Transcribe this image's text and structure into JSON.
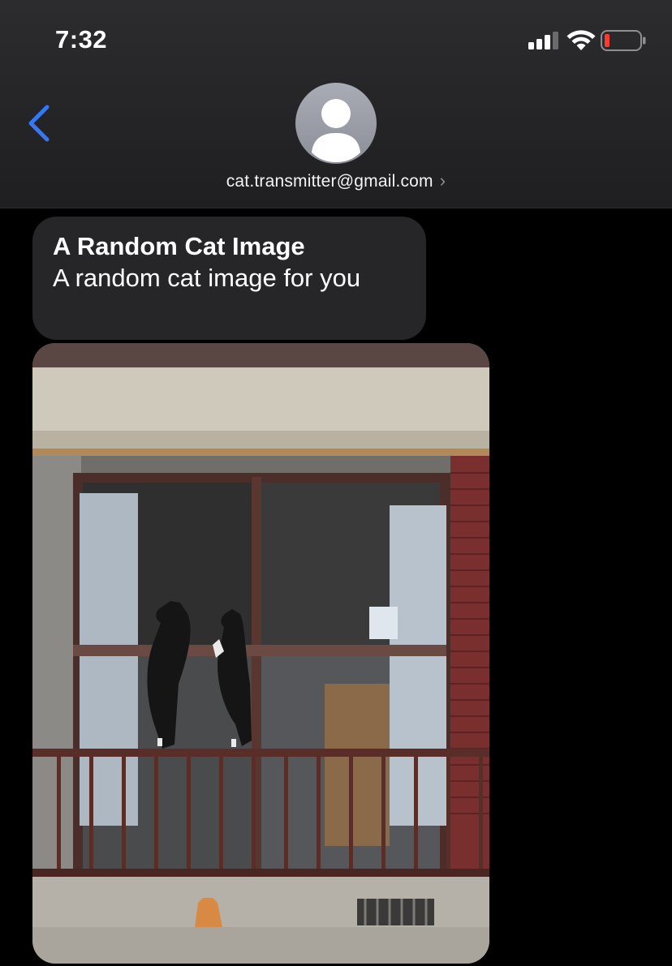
{
  "status_bar": {
    "time": "7:32",
    "icons": [
      "cellular-signal-icon",
      "wifi-icon",
      "battery-low-icon"
    ],
    "battery_color": "#ff3b30"
  },
  "header": {
    "back_icon": "chevron-left-icon",
    "avatar_icon": "person-silhouette-icon",
    "contact": "cat.transmitter@gmail.com",
    "contact_chevron": "›",
    "accent_color": "#3478f6"
  },
  "message": {
    "title": "A Random Cat Image",
    "body": "A random cat image for you",
    "bubble_color": "#262628"
  },
  "attachment": {
    "type": "image",
    "subject": "two cats standing on a balcony railing looking through a window, orange cat below"
  }
}
